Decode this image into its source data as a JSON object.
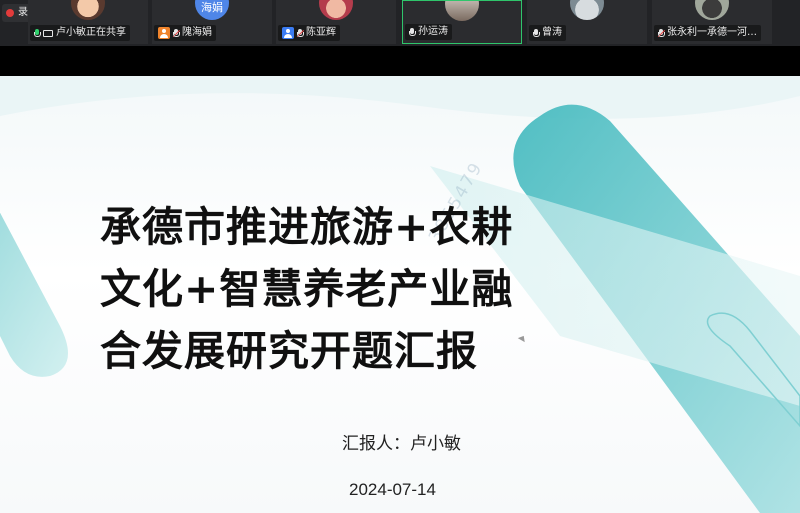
{
  "recording": {
    "label": "录制中"
  },
  "participants": [
    {
      "name": "卢小敏正在共享",
      "status": "sharing",
      "avatar_text": ""
    },
    {
      "name": "隗海娟",
      "status": "muted",
      "avatar_text": "海娟"
    },
    {
      "name": "陈亚辉",
      "status": "muted",
      "avatar_text": ""
    },
    {
      "name": "孙运涛",
      "status": "speaking",
      "avatar_text": ""
    },
    {
      "name": "曾涛",
      "status": "mic",
      "avatar_text": ""
    },
    {
      "name": "张永利一承德一河…",
      "status": "muted",
      "avatar_text": ""
    }
  ],
  "slide": {
    "title_lines": [
      "承德市推进旅游+农耕",
      "文化+智慧养老产业融",
      "合发展研究开题汇报"
    ],
    "reporter": "汇报人：卢小敏",
    "date": "2024-07-14",
    "watermark": "3855479"
  },
  "colors": {
    "accent_teal": "#3bb9be",
    "speaking_border": "#2fc56b",
    "recording_dot": "#e23b3b"
  }
}
